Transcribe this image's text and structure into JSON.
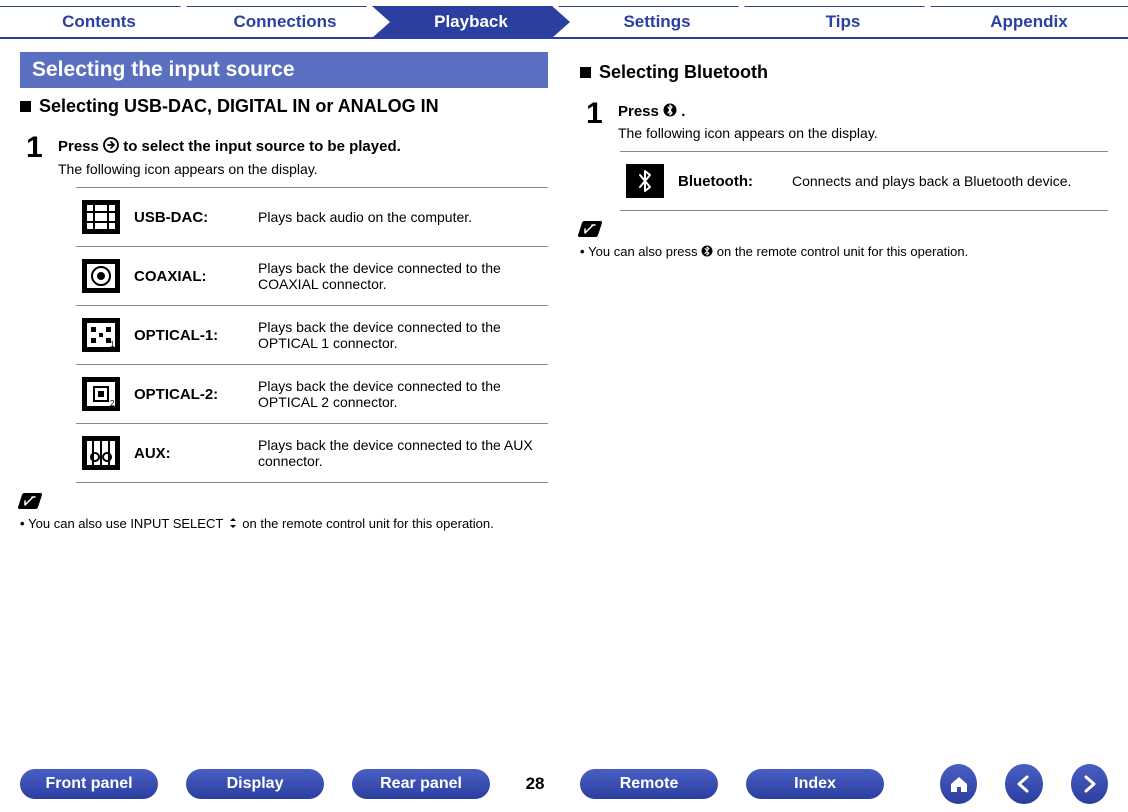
{
  "nav": {
    "tabs": [
      "Contents",
      "Connections",
      "Playback",
      "Settings",
      "Tips",
      "Appendix"
    ],
    "active_index": 2
  },
  "left": {
    "banner": "Selecting the input source",
    "heading": "Selecting USB-DAC, DIGITAL IN or ANALOG IN",
    "step1": {
      "number": "1",
      "title_before": "Press ",
      "title_after": " to select the input source to be played.",
      "subtitle": "The following icon appears on the display."
    },
    "sources": [
      {
        "label": "USB-DAC:",
        "desc": "Plays back audio on the computer."
      },
      {
        "label": "COAXIAL:",
        "desc": "Plays back the device connected to the COAXIAL connector."
      },
      {
        "label": "OPTICAL-1:",
        "desc": "Plays back the device connected to the OPTICAL 1 connector."
      },
      {
        "label": "OPTICAL-2:",
        "desc": "Plays back the device connected to the OPTICAL 2 connector."
      },
      {
        "label": "AUX:",
        "desc": "Plays back the device connected to the AUX connector."
      }
    ],
    "note_before": "You can also use INPUT SELECT ",
    "note_after": " on the remote control unit for this operation."
  },
  "right": {
    "heading": "Selecting Bluetooth",
    "step1": {
      "number": "1",
      "title_before": "Press ",
      "title_after": ".",
      "subtitle": "The following icon appears on the display."
    },
    "sources": [
      {
        "label": "Bluetooth:",
        "desc": "Connects and plays back a Bluetooth device."
      }
    ],
    "note_before": "You can also press ",
    "note_after": " on the remote control unit for this operation."
  },
  "bottom": {
    "buttons": [
      "Front panel",
      "Display",
      "Rear panel",
      "Remote",
      "Index"
    ],
    "page": "28"
  }
}
